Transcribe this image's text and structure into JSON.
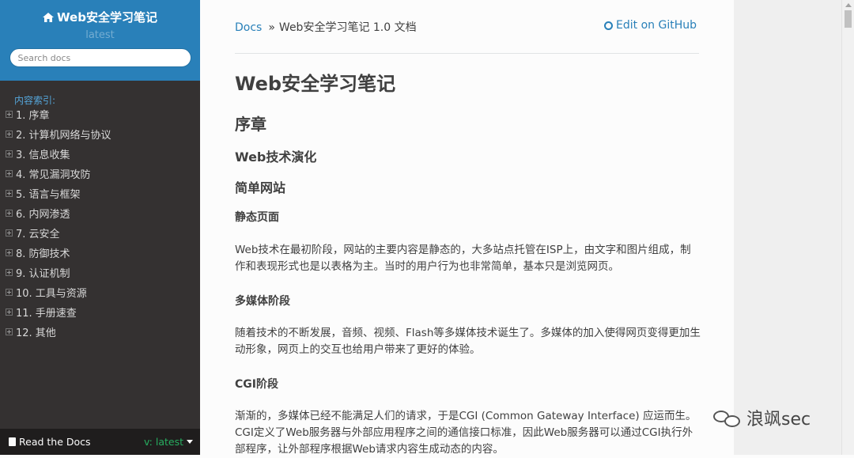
{
  "sidebar": {
    "project_title": "Web安全学习笔记",
    "version": "latest",
    "search_placeholder": "Search docs",
    "caption": "内容索引:",
    "items": [
      {
        "label": "1. 序章"
      },
      {
        "label": "2. 计算机网络与协议"
      },
      {
        "label": "3. 信息收集"
      },
      {
        "label": "4. 常见漏洞攻防"
      },
      {
        "label": "5. 语言与框架"
      },
      {
        "label": "6. 内网渗透"
      },
      {
        "label": "7. 云安全"
      },
      {
        "label": "8. 防御技术"
      },
      {
        "label": "9. 认证机制"
      },
      {
        "label": "10. 工具与资源"
      },
      {
        "label": "11. 手册速查"
      },
      {
        "label": "12. 其他"
      }
    ],
    "footer": {
      "label": "Read the Docs",
      "version": "v: latest"
    }
  },
  "breadcrumb": {
    "home": "Docs",
    "separator": "»",
    "current": "Web安全学习笔记 1.0 文档"
  },
  "github_link": "Edit on GitHub",
  "content": {
    "h1": "Web安全学习笔记",
    "h2": "序章",
    "h3": "Web技术演化",
    "h4_site": "简单网站",
    "h5_static": "静态页面",
    "p_static": "Web技术在最初阶段，网站的主要内容是静态的，大多站点托管在ISP上，由文字和图片组成，制作和表现形式也是以表格为主。当时的用户行为也非常简单，基本只是浏览网页。",
    "h5_multimedia": "多媒体阶段",
    "p_multimedia": "随着技术的不断发展，音频、视频、Flash等多媒体技术诞生了。多媒体的加入使得网页变得更加生动形象，网页上的交互也给用户带来了更好的体验。",
    "h5_cgi": "CGI阶段",
    "p_cgi": "渐渐的，多媒体已经不能满足人们的请求，于是CGI (Common Gateway Interface) 应运而生。CGI定义了Web服务器与外部应用程序之间的通信接口标准，因此Web服务器可以通过CGI执行外部程序，让外部程序根据Web请求内容生成动态的内容。"
  },
  "watermark": "浪飒sec",
  "colors": {
    "accent": "#2980b9",
    "sidebar_bg": "#343131",
    "version_green": "#27ae60"
  }
}
